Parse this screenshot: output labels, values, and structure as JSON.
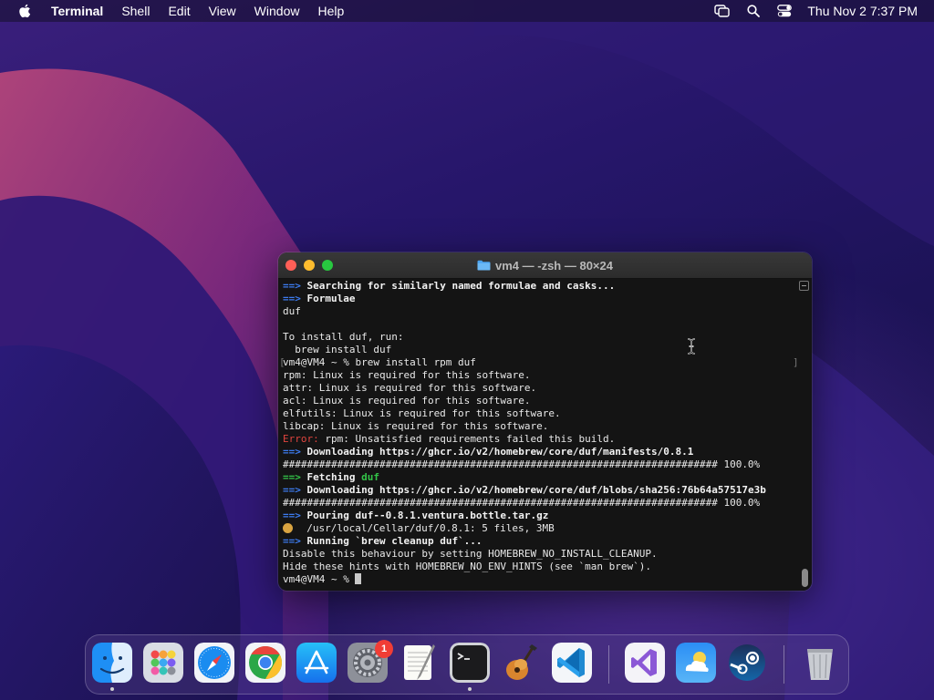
{
  "menubar": {
    "app_name": "Terminal",
    "menus": [
      "Shell",
      "Edit",
      "View",
      "Window",
      "Help"
    ],
    "clock": "Thu Nov 2  7:37 PM"
  },
  "window": {
    "title": "vm4 — -zsh — 80×24"
  },
  "terminal": {
    "lines": [
      {
        "segments": [
          {
            "text": "==> ",
            "style": "arrow"
          },
          {
            "text": "Searching for similarly named formulae and casks...",
            "style": "bold"
          }
        ]
      },
      {
        "segments": [
          {
            "text": "==> ",
            "style": "arrow"
          },
          {
            "text": "Formulae",
            "style": "bold"
          }
        ]
      },
      {
        "segments": [
          {
            "text": "duf",
            "style": "plain"
          }
        ]
      },
      {
        "segments": [
          {
            "text": "",
            "style": "plain"
          }
        ]
      },
      {
        "segments": [
          {
            "text": "To install duf, run:",
            "style": "plain"
          }
        ]
      },
      {
        "segments": [
          {
            "text": "  brew install duf",
            "style": "plain"
          }
        ]
      },
      {
        "segments": [
          {
            "text": "vm4@VM4 ~ % brew install rpm duf",
            "style": "plain"
          }
        ]
      },
      {
        "segments": [
          {
            "text": "rpm: Linux is required for this software.",
            "style": "plain"
          }
        ]
      },
      {
        "segments": [
          {
            "text": "attr: Linux is required for this software.",
            "style": "plain"
          }
        ]
      },
      {
        "segments": [
          {
            "text": "acl: Linux is required for this software.",
            "style": "plain"
          }
        ]
      },
      {
        "segments": [
          {
            "text": "elfutils: Linux is required for this software.",
            "style": "plain"
          }
        ]
      },
      {
        "segments": [
          {
            "text": "libcap: Linux is required for this software.",
            "style": "plain"
          }
        ]
      },
      {
        "segments": [
          {
            "text": "Error:",
            "style": "err"
          },
          {
            "text": " rpm: Unsatisfied requirements failed this build.",
            "style": "plain"
          }
        ]
      },
      {
        "segments": [
          {
            "text": "==> ",
            "style": "arrow"
          },
          {
            "text": "Downloading https://ghcr.io/v2/homebrew/core/duf/manifests/0.8.1",
            "style": "bold"
          }
        ]
      },
      {
        "segments": [
          {
            "text": "######################################################################## 100.0%",
            "style": "plain"
          }
        ]
      },
      {
        "segments": [
          {
            "text": "==> ",
            "style": "arrow-green"
          },
          {
            "text": "Fetching ",
            "style": "bold"
          },
          {
            "text": "duf",
            "style": "green"
          }
        ]
      },
      {
        "segments": [
          {
            "text": "==> ",
            "style": "arrow"
          },
          {
            "text": "Downloading https://ghcr.io/v2/homebrew/core/duf/blobs/sha256:76b64a57517e3b",
            "style": "bold"
          }
        ]
      },
      {
        "segments": [
          {
            "text": "######################################################################## 100.0%",
            "style": "plain"
          }
        ]
      },
      {
        "segments": [
          {
            "text": "==> ",
            "style": "arrow"
          },
          {
            "text": "Pouring duf--0.8.1.ventura.bottle.tar.gz",
            "style": "bold"
          }
        ]
      },
      {
        "segments": [
          {
            "text": "🍺",
            "style": "emoji"
          },
          {
            "text": "  /usr/local/Cellar/duf/0.8.1: 5 files, 3MB",
            "style": "plain"
          }
        ]
      },
      {
        "segments": [
          {
            "text": "==> ",
            "style": "arrow"
          },
          {
            "text": "Running `brew cleanup duf`...",
            "style": "bold"
          }
        ]
      },
      {
        "segments": [
          {
            "text": "Disable this behaviour by setting HOMEBREW_NO_INSTALL_CLEANUP.",
            "style": "plain"
          }
        ]
      },
      {
        "segments": [
          {
            "text": "Hide these hints with HOMEBREW_NO_ENV_HINTS (see `man brew`).",
            "style": "plain"
          }
        ]
      },
      {
        "segments": [
          {
            "text": "vm4@VM4 ~ % ",
            "style": "plain"
          }
        ],
        "cursor": true
      }
    ]
  },
  "dock": {
    "items": [
      "finder-icon",
      "launchpad-icon",
      "safari-icon",
      "chrome-icon",
      "app-store-icon",
      "system-settings-icon",
      "textedit-icon",
      "terminal-icon",
      "garageband-icon",
      "vscode-icon",
      "visual-studio-icon",
      "weather-icon",
      "steam-icon",
      "trash-icon"
    ],
    "settings_badge": "1"
  },
  "colors": {
    "arrow_blue": "#3d7cf0",
    "green": "#33c448",
    "error_red": "#e0443e"
  }
}
